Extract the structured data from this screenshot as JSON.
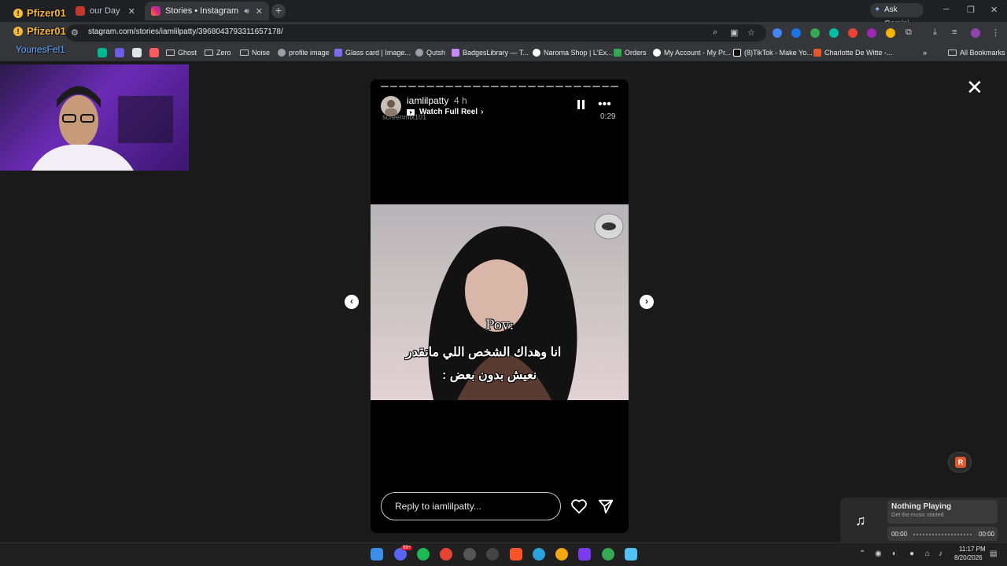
{
  "browser": {
    "tabs": [
      {
        "label": "our Day",
        "active": false
      },
      {
        "label": "Stories • Instagram",
        "active": true
      }
    ],
    "new_tab_symbol": "+",
    "ask_gemini": "Ask Gemini",
    "url": "stagram.com/stories/iamlilpatty/3968043793311657178/",
    "bookmarks": [
      {
        "label": "Ghost",
        "type": "folder"
      },
      {
        "label": "Zero",
        "type": "folder"
      },
      {
        "label": "Noise",
        "type": "folder"
      },
      {
        "label": "profile image",
        "type": "link",
        "color": "#9aa0a6"
      },
      {
        "label": "Glass card | Image...",
        "type": "link",
        "color": "#7c6cf0"
      },
      {
        "label": "Qutsh",
        "type": "link",
        "color": "#9aa0a6"
      },
      {
        "label": "BadgesLibrary — T...",
        "type": "link",
        "color": "#c58af9"
      },
      {
        "label": "Naroma Shop | L'Ex...",
        "type": "link",
        "color": "#ffffff"
      },
      {
        "label": "Orders",
        "type": "link",
        "color": "#34a853"
      },
      {
        "label": "My Account - My Pr...",
        "type": "link",
        "color": "#ffffff"
      },
      {
        "label": "(8)TikTok - Make Yo...",
        "type": "link",
        "color": "#ffffff"
      },
      {
        "label": "Charlotte De Witte -...",
        "type": "link",
        "color": "#e2572b"
      }
    ],
    "all_bookmarks": "All Bookmarks"
  },
  "overlay": {
    "names": [
      "Pfizer01",
      "Pfizer01"
    ],
    "badge": "!",
    "follower": "YounesFel1"
  },
  "story": {
    "username": "iamlilpatty",
    "time_ago": "4 h",
    "watch_full_reel": "Watch Full Reel",
    "channel_mark": "screenmix101",
    "duration": "0:29",
    "more": "•••",
    "pov": "Pov:",
    "caption_line1": "انا وهداك الشخص اللي مانقدر",
    "caption_line2": "نعيش بدون بعض :",
    "reply_placeholder": "Reply to iamlilpatty...",
    "progress_segments": 26
  },
  "music_widget": {
    "title": "Nothing Playing",
    "subtitle": "Get the music started",
    "elapsed": "00:00",
    "total": "00:00"
  },
  "taskbar": {
    "time": "11:17 PM",
    "date": "8/20/2026",
    "notification_count": "99+"
  },
  "colors": {
    "overlay_name": "#f6b93b",
    "follower": "#62a8ff",
    "webcam_bg": "#6b2bb5"
  }
}
